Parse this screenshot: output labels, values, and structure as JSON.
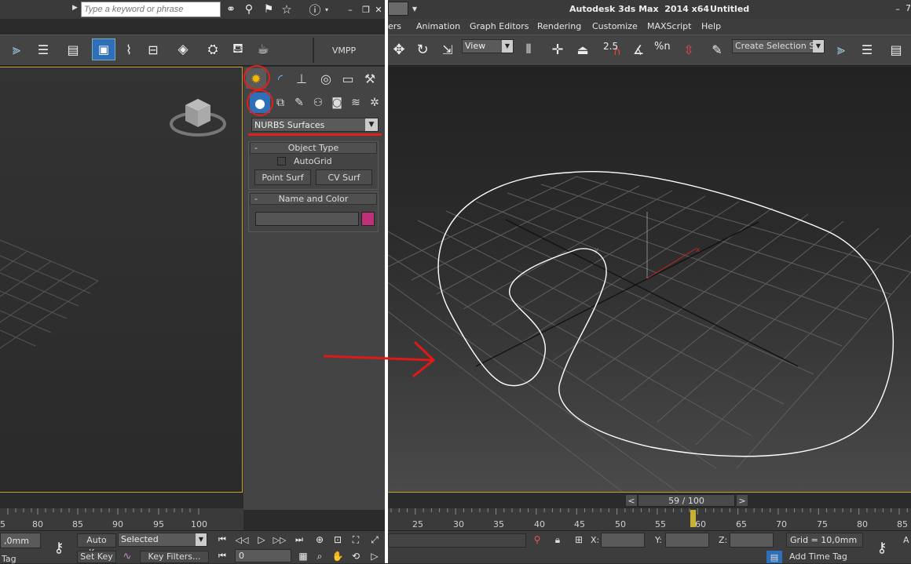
{
  "search": {
    "placeholder": "Type a keyword or phrase"
  },
  "window": {
    "app_title": "Autodesk 3ds Max  2014 x64",
    "doc_title": "Untitled",
    "right_edge_char": "7"
  },
  "menu": [
    "ers",
    "Animation",
    "Graph Editors",
    "Rendering",
    "Customize",
    "MAXScript",
    "Help"
  ],
  "toolbar_left": {
    "vmpp": "VMPP"
  },
  "toolbar_right": {
    "view_select": "View",
    "snap_angle": "2.5",
    "named_selection": "Create Selection Se",
    "percent_snap": "%n"
  },
  "command_panel": {
    "dropdown_value": "NURBS Surfaces",
    "object_type_title": "Object Type",
    "autogrid_label": "AutoGrid",
    "point_surf": "Point Surf",
    "cv_surf": "CV Surf",
    "name_color_title": "Name and Color",
    "minus": "-",
    "color_swatch": "#c0307a"
  },
  "timeline": {
    "left_ticks": [
      "5",
      "80",
      "85",
      "90",
      "95",
      "100"
    ],
    "right_ticks": [
      "25",
      "30",
      "35",
      "40",
      "45",
      "50",
      "55",
      "60",
      "65",
      "70",
      "75",
      "80",
      "85"
    ],
    "frame_readout": "59 / 100",
    "prev": "<",
    "next": ">"
  },
  "status_left": {
    "unit_value": ",0mm",
    "auto_key": "Auto Key",
    "selected": "Selected",
    "set_key": "Set Key",
    "key_filters": "Key Filters...",
    "frame_field": "0",
    "tag": "Tag"
  },
  "status_right": {
    "x_label": "X:",
    "y_label": "Y:",
    "z_label": "Z:",
    "grid": "Grid = 10,0mm",
    "add_time_tag": "Add Time Tag",
    "right_edge_char": "A"
  },
  "colors": {
    "highlight_red": "#e02020",
    "viewport_border": "#c8a030",
    "curve": "#ffffff",
    "arrow": "#e01818"
  }
}
